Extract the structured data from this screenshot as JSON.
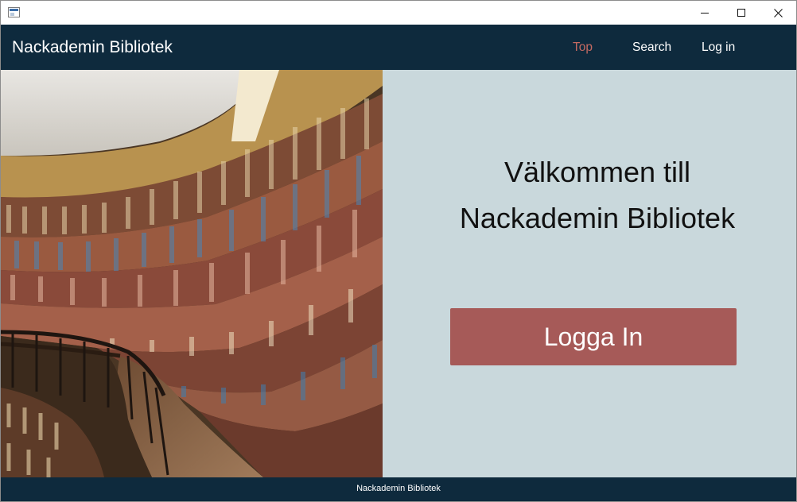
{
  "window": {
    "app_icon": "window-app-icon",
    "controls": {
      "minimize": "minimize-icon",
      "maximize": "maximize-icon",
      "close": "close-icon"
    }
  },
  "navbar": {
    "brand": "Nackademin Bibliotek",
    "links": [
      {
        "label": "Top",
        "active": true
      },
      {
        "label": "Search",
        "active": false
      },
      {
        "label": "Log in",
        "active": false
      }
    ]
  },
  "hero": {
    "image": "library-bookshelves-photo"
  },
  "welcome": {
    "title_line1": "Välkommen till",
    "title_line2": "Nackademin Bibliotek",
    "login_button": "Logga In"
  },
  "footer": {
    "text": "Nackademin Bibliotek"
  },
  "colors": {
    "navbar_bg": "#0e2a3d",
    "active_link": "#c46a62",
    "panel_bg": "#c9d8dc",
    "button_bg": "#a65a58"
  }
}
